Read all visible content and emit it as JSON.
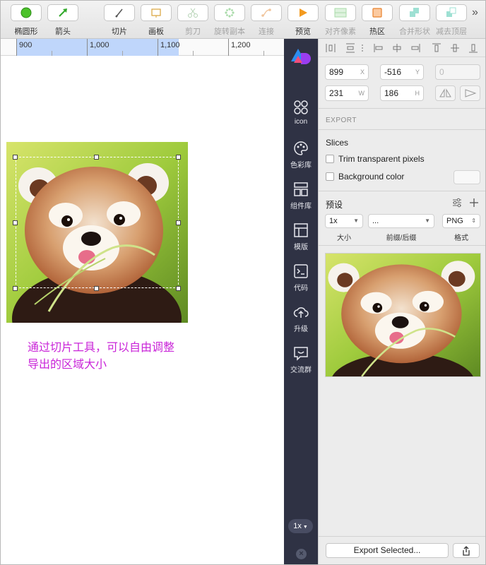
{
  "toolbar": {
    "tools": [
      {
        "label": "椭圆形",
        "icon": "oval-icon",
        "enabled": true
      },
      {
        "label": "箭头",
        "icon": "arrow-icon",
        "enabled": true
      },
      {
        "label": "切片",
        "icon": "slice-icon",
        "enabled": true
      },
      {
        "label": "画板",
        "icon": "artboard-icon",
        "enabled": true
      },
      {
        "label": "剪刀",
        "icon": "scissors-icon",
        "enabled": false
      },
      {
        "label": "旋转副本",
        "icon": "rotate-copies-icon",
        "enabled": false
      },
      {
        "label": "连接",
        "icon": "connect-icon",
        "enabled": false
      },
      {
        "label": "预览",
        "icon": "preview-play-icon",
        "enabled": true
      },
      {
        "label": "对齐像素",
        "icon": "align-pixels-icon",
        "enabled": false
      },
      {
        "label": "热区",
        "icon": "hotspot-icon",
        "enabled": true
      },
      {
        "label": "合并形状",
        "icon": "union-icon",
        "enabled": false
      },
      {
        "label": "减去顶层",
        "icon": "subtract-icon",
        "enabled": false
      }
    ],
    "more": "»"
  },
  "ruler": {
    "labels": [
      "900",
      "1,000",
      "1,100",
      "1,200"
    ]
  },
  "canvas": {
    "note_line1": "通过切片工具，可以自由调整",
    "note_line2": "导出的区域大小"
  },
  "sidebar": {
    "items": [
      {
        "label": "icon",
        "icon": "icon-grid-icon"
      },
      {
        "label": "色彩库",
        "icon": "palette-icon"
      },
      {
        "label": "组件库",
        "icon": "components-icon"
      },
      {
        "label": "模版",
        "icon": "template-icon"
      },
      {
        "label": "代码",
        "icon": "code-icon"
      },
      {
        "label": "升级",
        "icon": "upgrade-cloud-icon"
      },
      {
        "label": "交流群",
        "icon": "chat-icon"
      }
    ],
    "scale": "1x"
  },
  "inspector": {
    "x": "899",
    "x_unit": "X",
    "y": "-516",
    "y_unit": "Y",
    "rotation": "0",
    "w": "231",
    "w_unit": "W",
    "h": "186",
    "h_unit": "H",
    "export_title": "EXPORT",
    "slices_title": "Slices",
    "trim_label": "Trim transparent pixels",
    "trim_checked": false,
    "bg_label": "Background color",
    "bg_checked": false,
    "preset_title": "预设",
    "size_value": "1x",
    "suffix_value": "...",
    "format_value": "PNG",
    "size_label": "大小",
    "suffix_label": "前缀/后缀",
    "format_label": "格式",
    "export_button": "Export Selected...",
    "accent": "#c924d8"
  }
}
